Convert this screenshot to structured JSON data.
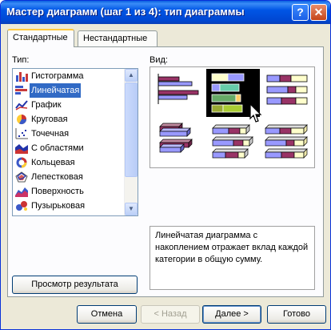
{
  "window": {
    "title": "Мастер диаграмм (шаг 1 из 4): тип диаграммы",
    "help_glyph": "?",
    "close_glyph": "✕"
  },
  "tabs": [
    {
      "label": "Стандартные"
    },
    {
      "label": "Нестандартные"
    }
  ],
  "type_label": "Тип:",
  "view_label": "Вид:",
  "chart_types": [
    {
      "label": "Гистограмма",
      "icon": "column-chart-icon"
    },
    {
      "label": "Линейчатая",
      "icon": "bar-chart-icon",
      "selected": true
    },
    {
      "label": "График",
      "icon": "line-chart-icon"
    },
    {
      "label": "Круговая",
      "icon": "pie-chart-icon"
    },
    {
      "label": "Точечная",
      "icon": "scatter-chart-icon"
    },
    {
      "label": "С областями",
      "icon": "area-chart-icon"
    },
    {
      "label": "Кольцевая",
      "icon": "doughnut-chart-icon"
    },
    {
      "label": "Лепестковая",
      "icon": "radar-chart-icon"
    },
    {
      "label": "Поверхность",
      "icon": "surface-chart-icon"
    },
    {
      "label": "Пузырьковая",
      "icon": "bubble-chart-icon"
    }
  ],
  "subtypes": [
    {
      "name": "clustered-bar",
      "selected": false
    },
    {
      "name": "stacked-bar",
      "selected": true
    },
    {
      "name": "100-percent-stacked-bar",
      "selected": false
    },
    {
      "name": "3d-clustered-bar",
      "selected": false
    },
    {
      "name": "3d-stacked-bar",
      "selected": false
    },
    {
      "name": "3d-100-percent-stacked-bar",
      "selected": false
    }
  ],
  "description": "Линейчатая диаграмма с накоплением отражает вклад каждой категории в общую сумму.",
  "preview_button": "Просмотр результата",
  "buttons": {
    "cancel": "Отмена",
    "back": "< Назад",
    "next": "Далее >",
    "finish": "Готово"
  },
  "colors": {
    "series1": "#9999ff",
    "series2": "#993366",
    "series3": "#ffffcc",
    "selected_bg": "#000000",
    "title_bar": "#0055e5"
  }
}
